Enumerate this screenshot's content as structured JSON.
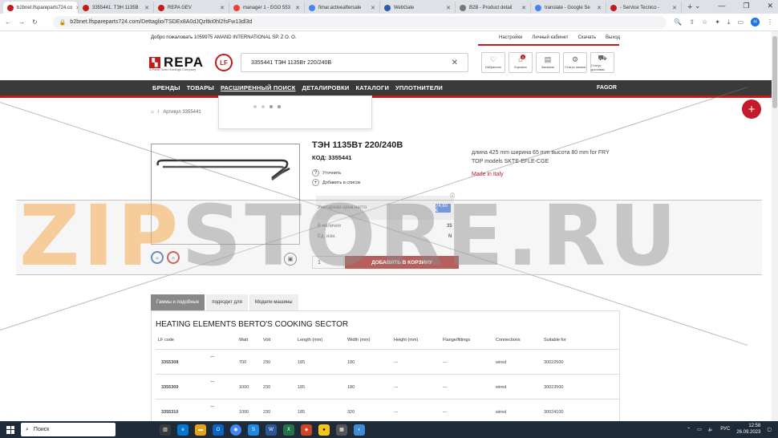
{
  "browser": {
    "tabs": [
      {
        "title": "b2bnet.lfspareparts724.co",
        "color": "#c41a1a",
        "active": true
      },
      {
        "title": "3355441. ТЭН 1135В",
        "color": "#c41a1a"
      },
      {
        "title": "REPA GEV",
        "color": "#c41a1a"
      },
      {
        "title": "manager 1 - EGO 553",
        "color": "#ea4335"
      },
      {
        "title": "fimar.activeaftersale",
        "color": "#4285f4"
      },
      {
        "title": "WebGate",
        "color": "#2a5da8"
      },
      {
        "title": "B2B - Product detail",
        "color": "#777"
      },
      {
        "title": "translate - Google Se",
        "color": "#4285f4"
      },
      {
        "title": "- Service Tecnico -",
        "color": "#c41a1a"
      }
    ],
    "new_tab": "+",
    "url": "b2bnet.lfspareparts724.com/Dettaglio/TSDEx8A0dJQzltki0hl2fsFw13dl3d",
    "profile_initial": "H"
  },
  "header": {
    "welcome": "Добро пожаловать 1059975 AMAND INTERNATIONAL SP. Z O. O.",
    "links": [
      "Настройки",
      "Личный кабинет",
      "Скачать",
      "Выход"
    ],
    "logo_text": "REPA",
    "logo_sub": "A Parts Town Holdings Company",
    "lf_text": "LF",
    "search_value": "3355441 ТЭН 1135Вт 220/240В",
    "icon_buttons": [
      {
        "label": "Избранное",
        "glyph": "♡"
      },
      {
        "label": "Корзина",
        "glyph": "⌂",
        "count": "0"
      },
      {
        "label": "Заказать",
        "glyph": "▤"
      },
      {
        "label": "Статус заказа",
        "glyph": "⚙"
      },
      {
        "label": "Статус доставки",
        "glyph": "⛟"
      }
    ]
  },
  "nav": {
    "items": [
      "БРЕНДЫ",
      "ТОВАРЫ",
      "РАСШИРЕННЫЙ ПОИСК",
      "ДЕТАЛИРОВКИ",
      "КАТАЛОГИ",
      "УПЛОТНИТЕЛИ"
    ],
    "fagor": "FAGOR"
  },
  "breadcrumb": {
    "home": "⌂",
    "sep": "/",
    "current": "Артикул 3355441"
  },
  "product": {
    "title": "ТЭН 1135Вт 220/240В",
    "code": "КОД: 3355441",
    "description": "длина 425 mm ширина 65 mm высота 80 mm for FRY TOP models SKTE-EFLE-CGE",
    "made_in": "Made in Italy",
    "ask": "Уточнить",
    "add_list": "Добавить в список",
    "unit_price_label": "Унитарная цена нетто",
    "unit_price_value": "24,80 €",
    "stock_label": "В наличии",
    "stock_value": "35",
    "unit_label": "Ед. изм.",
    "unit_value": "N",
    "qty": "1",
    "add_to_cart": "ДОБАВИТЬ В КОРЗИНУ"
  },
  "product_tabs": [
    "Гаммы и подобные",
    "подходит для",
    "Модели машины"
  ],
  "table": {
    "title": "HEATING ELEMENTS BERTO'S COOKING SECTOR",
    "headers": [
      "LF code",
      "Watt",
      "Volt",
      "Length (mm)",
      "Width (mm)",
      "Height (mm)",
      "Flange/fittings",
      "Connections",
      "Suitable for"
    ],
    "rows": [
      [
        "3355308",
        "700",
        "230",
        "185",
        "180",
        "---",
        "---",
        "wired",
        "30022500"
      ],
      [
        "3355309",
        "1000",
        "230",
        "185",
        "180",
        "---",
        "---",
        "wired",
        "30023500"
      ],
      [
        "3355310",
        "1000",
        "230",
        "185",
        "320",
        "---",
        "---",
        "wired",
        "30024100"
      ]
    ]
  },
  "watermark": {
    "part1": "ZIP",
    "part2": "STORE.RU"
  },
  "taskbar": {
    "search": "Поиск",
    "lang": "РУС",
    "time": "12:58",
    "date": "26.09.2023"
  }
}
